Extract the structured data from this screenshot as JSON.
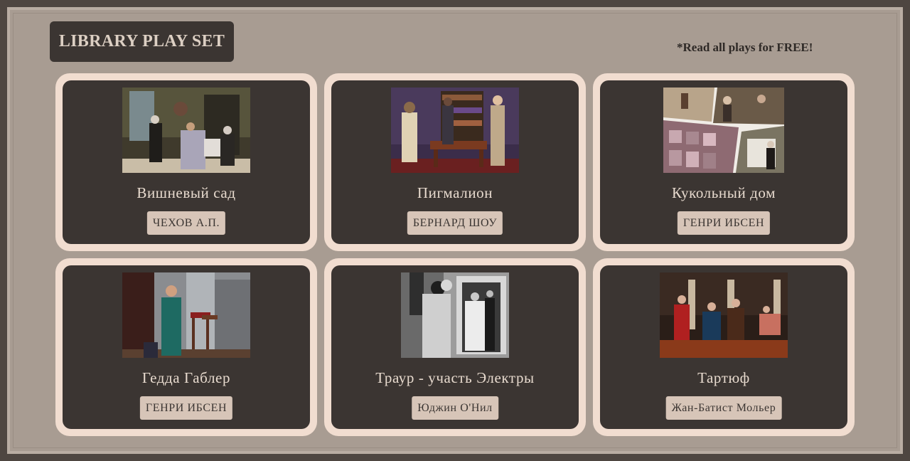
{
  "header": {
    "title": "LIBRARY PLAY SET",
    "note": "*Read all plays for FREE!"
  },
  "plays": [
    {
      "title": "Вишневый сад",
      "author": "ЧЕХОВ А.П.",
      "image": "stage-photo-cherry-orchard"
    },
    {
      "title": "Пигмалион",
      "author": "БЕРНАРД ШОУ",
      "image": "stage-photo-pygmalion"
    },
    {
      "title": "Кукольный дом",
      "author": "ГЕНРИ ИБСЕН",
      "image": "collage-dolls-house"
    },
    {
      "title": "Гедда Габлер",
      "author": "ГЕНРИ ИБСЕН",
      "image": "stage-photo-hedda-gabler"
    },
    {
      "title": "Траур - участь Электры",
      "author": "Юджин О'Нил",
      "image": "bw-photo-mourning-becomes-electra"
    },
    {
      "title": "Тартюф",
      "author": "Жан-Батист Мольер",
      "image": "stage-photo-tartuffe"
    }
  ],
  "colors": {
    "background": "#a89c92",
    "card_border": "#f1ddd0",
    "card_fill": "#3b3532",
    "button_fill": "#d7c5b8"
  }
}
